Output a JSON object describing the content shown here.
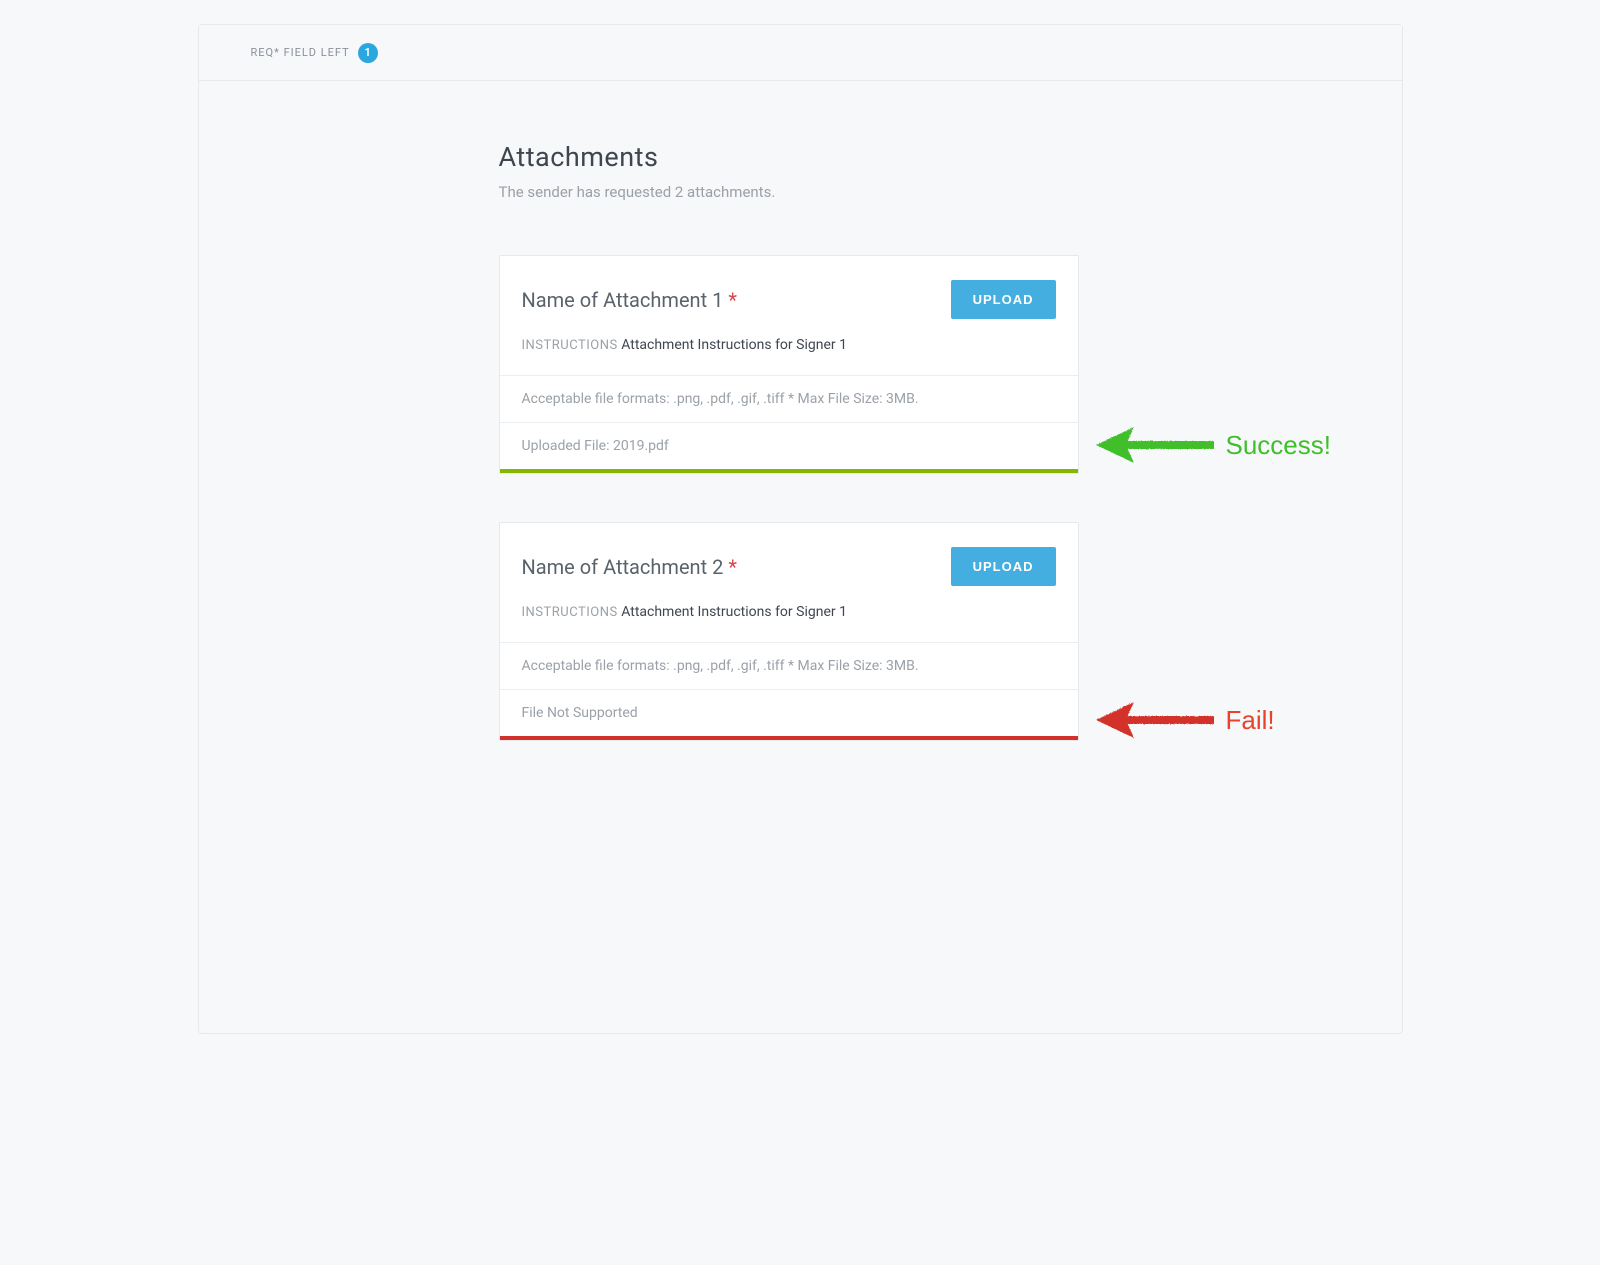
{
  "topbar": {
    "req_label": "REQ* FIELD LEFT",
    "count": "1"
  },
  "page": {
    "title": "Attachments",
    "subtitle": "The sender has requested 2 attachments."
  },
  "upload_label": "UPLOAD",
  "instructions_label": "INSTRUCTIONS",
  "attachments": [
    {
      "title": "Name of Attachment 1",
      "required_star": "*",
      "instructions": "Attachment Instructions for Signer 1",
      "formats": "Acceptable file formats: .png, .pdf, .gif, .tiff * Max File Size: 3MB.",
      "status_text": "Uploaded File: 2019.pdf"
    },
    {
      "title": "Name of Attachment 2",
      "required_star": "*",
      "instructions": "Attachment Instructions for Signer 1",
      "formats": "Acceptable file formats: .png, .pdf, .gif, .tiff * Max File Size: 3MB.",
      "status_text": "File Not Supported"
    }
  ],
  "annotations": {
    "success": "Success!",
    "fail": "Fail!"
  },
  "colors": {
    "accent": "#44aee0",
    "success": "#86b700",
    "fail": "#d2302a",
    "annot_success": "#3fbf2b",
    "annot_fail": "#e8432a"
  }
}
